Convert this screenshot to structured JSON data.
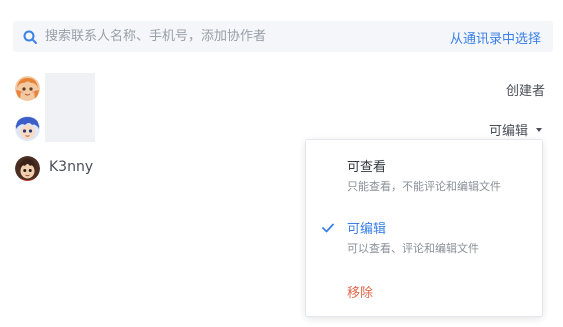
{
  "search": {
    "placeholder": "搜索联系人名称、手机号，添加协作者",
    "contacts_link": "从通讯录中选择"
  },
  "members": [
    {
      "avatar": "orange-hair-avatar",
      "name": "",
      "role": "创建者"
    },
    {
      "avatar": "blue-hair-avatar",
      "name": "",
      "role": "可编辑"
    },
    {
      "avatar": "dark-hair-avatar",
      "name": "K3nny",
      "role": ""
    }
  ],
  "permission_menu": {
    "options": [
      {
        "title": "可查看",
        "desc": "只能查看，不能评论和编辑文件",
        "selected": false
      },
      {
        "title": "可编辑",
        "desc": "可以查看、评论和编辑文件",
        "selected": true
      }
    ],
    "remove_label": "移除"
  },
  "colors": {
    "accent": "#3a80e8",
    "danger": "#e0684a",
    "search_bg": "#f4f6f9"
  },
  "icons": {
    "search": "search-icon",
    "dropdown": "caret-down-icon",
    "selected": "check-icon"
  }
}
